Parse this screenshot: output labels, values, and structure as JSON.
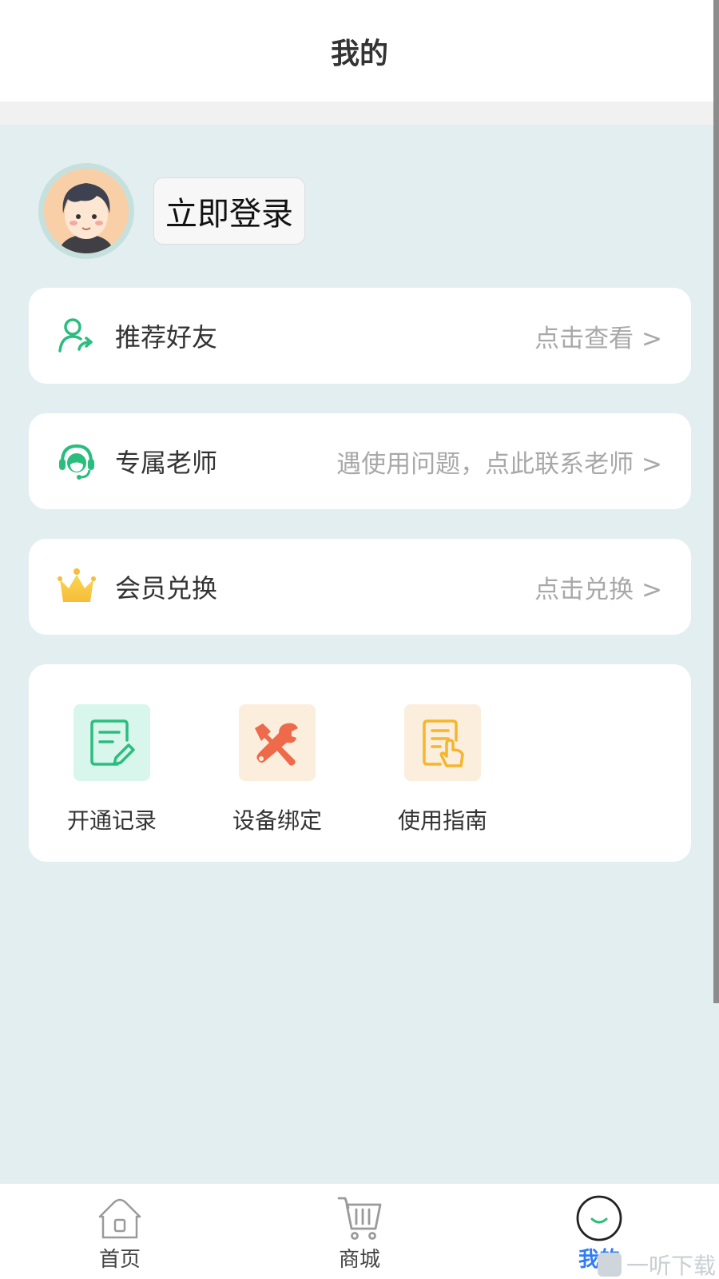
{
  "header": {
    "title": "我的"
  },
  "profile": {
    "login_label": "立即登录"
  },
  "menu": [
    {
      "icon": "user-share-icon",
      "label": "推荐好友",
      "hint": "点击查看 >"
    },
    {
      "icon": "headset-icon",
      "label": "专属老师",
      "hint": "遇使用问题，点此联系老师 >"
    },
    {
      "icon": "crown-icon",
      "label": "会员兑换",
      "hint": "点击兑换 >"
    }
  ],
  "tools": [
    {
      "icon": "record-edit-icon",
      "label": "开通记录"
    },
    {
      "icon": "wrench-screwdriver-icon",
      "label": "设备绑定"
    },
    {
      "icon": "guide-document-icon",
      "label": "使用指南"
    }
  ],
  "tabbar": {
    "items": [
      {
        "icon": "home-icon",
        "label": "首页"
      },
      {
        "icon": "cart-icon",
        "label": "商城"
      },
      {
        "icon": "smile-icon",
        "label": "我的"
      }
    ],
    "active_index": 2
  },
  "watermark": "一听下载",
  "colors": {
    "page_bg": "#e3eef0",
    "accent_green": "#2bbd7e",
    "crown_yellow": "#f7c948",
    "tool_orange": "#ee6a4a",
    "guide_yellow": "#f5b52c",
    "active_tab_blue": "#2f7df6"
  }
}
